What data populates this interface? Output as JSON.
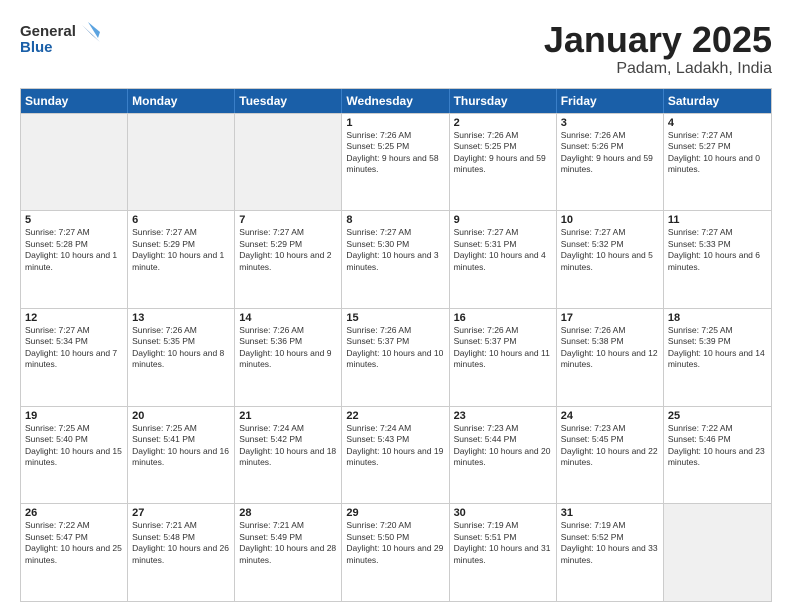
{
  "header": {
    "logo_general": "General",
    "logo_blue": "Blue",
    "month_title": "January 2025",
    "location": "Padam, Ladakh, India"
  },
  "weekdays": [
    "Sunday",
    "Monday",
    "Tuesday",
    "Wednesday",
    "Thursday",
    "Friday",
    "Saturday"
  ],
  "rows": [
    [
      {
        "day": "",
        "info": ""
      },
      {
        "day": "",
        "info": ""
      },
      {
        "day": "",
        "info": ""
      },
      {
        "day": "1",
        "info": "Sunrise: 7:26 AM\nSunset: 5:25 PM\nDaylight: 9 hours and 58 minutes."
      },
      {
        "day": "2",
        "info": "Sunrise: 7:26 AM\nSunset: 5:25 PM\nDaylight: 9 hours and 59 minutes."
      },
      {
        "day": "3",
        "info": "Sunrise: 7:26 AM\nSunset: 5:26 PM\nDaylight: 9 hours and 59 minutes."
      },
      {
        "day": "4",
        "info": "Sunrise: 7:27 AM\nSunset: 5:27 PM\nDaylight: 10 hours and 0 minutes."
      }
    ],
    [
      {
        "day": "5",
        "info": "Sunrise: 7:27 AM\nSunset: 5:28 PM\nDaylight: 10 hours and 1 minute."
      },
      {
        "day": "6",
        "info": "Sunrise: 7:27 AM\nSunset: 5:29 PM\nDaylight: 10 hours and 1 minute."
      },
      {
        "day": "7",
        "info": "Sunrise: 7:27 AM\nSunset: 5:29 PM\nDaylight: 10 hours and 2 minutes."
      },
      {
        "day": "8",
        "info": "Sunrise: 7:27 AM\nSunset: 5:30 PM\nDaylight: 10 hours and 3 minutes."
      },
      {
        "day": "9",
        "info": "Sunrise: 7:27 AM\nSunset: 5:31 PM\nDaylight: 10 hours and 4 minutes."
      },
      {
        "day": "10",
        "info": "Sunrise: 7:27 AM\nSunset: 5:32 PM\nDaylight: 10 hours and 5 minutes."
      },
      {
        "day": "11",
        "info": "Sunrise: 7:27 AM\nSunset: 5:33 PM\nDaylight: 10 hours and 6 minutes."
      }
    ],
    [
      {
        "day": "12",
        "info": "Sunrise: 7:27 AM\nSunset: 5:34 PM\nDaylight: 10 hours and 7 minutes."
      },
      {
        "day": "13",
        "info": "Sunrise: 7:26 AM\nSunset: 5:35 PM\nDaylight: 10 hours and 8 minutes."
      },
      {
        "day": "14",
        "info": "Sunrise: 7:26 AM\nSunset: 5:36 PM\nDaylight: 10 hours and 9 minutes."
      },
      {
        "day": "15",
        "info": "Sunrise: 7:26 AM\nSunset: 5:37 PM\nDaylight: 10 hours and 10 minutes."
      },
      {
        "day": "16",
        "info": "Sunrise: 7:26 AM\nSunset: 5:37 PM\nDaylight: 10 hours and 11 minutes."
      },
      {
        "day": "17",
        "info": "Sunrise: 7:26 AM\nSunset: 5:38 PM\nDaylight: 10 hours and 12 minutes."
      },
      {
        "day": "18",
        "info": "Sunrise: 7:25 AM\nSunset: 5:39 PM\nDaylight: 10 hours and 14 minutes."
      }
    ],
    [
      {
        "day": "19",
        "info": "Sunrise: 7:25 AM\nSunset: 5:40 PM\nDaylight: 10 hours and 15 minutes."
      },
      {
        "day": "20",
        "info": "Sunrise: 7:25 AM\nSunset: 5:41 PM\nDaylight: 10 hours and 16 minutes."
      },
      {
        "day": "21",
        "info": "Sunrise: 7:24 AM\nSunset: 5:42 PM\nDaylight: 10 hours and 18 minutes."
      },
      {
        "day": "22",
        "info": "Sunrise: 7:24 AM\nSunset: 5:43 PM\nDaylight: 10 hours and 19 minutes."
      },
      {
        "day": "23",
        "info": "Sunrise: 7:23 AM\nSunset: 5:44 PM\nDaylight: 10 hours and 20 minutes."
      },
      {
        "day": "24",
        "info": "Sunrise: 7:23 AM\nSunset: 5:45 PM\nDaylight: 10 hours and 22 minutes."
      },
      {
        "day": "25",
        "info": "Sunrise: 7:22 AM\nSunset: 5:46 PM\nDaylight: 10 hours and 23 minutes."
      }
    ],
    [
      {
        "day": "26",
        "info": "Sunrise: 7:22 AM\nSunset: 5:47 PM\nDaylight: 10 hours and 25 minutes."
      },
      {
        "day": "27",
        "info": "Sunrise: 7:21 AM\nSunset: 5:48 PM\nDaylight: 10 hours and 26 minutes."
      },
      {
        "day": "28",
        "info": "Sunrise: 7:21 AM\nSunset: 5:49 PM\nDaylight: 10 hours and 28 minutes."
      },
      {
        "day": "29",
        "info": "Sunrise: 7:20 AM\nSunset: 5:50 PM\nDaylight: 10 hours and 29 minutes."
      },
      {
        "day": "30",
        "info": "Sunrise: 7:19 AM\nSunset: 5:51 PM\nDaylight: 10 hours and 31 minutes."
      },
      {
        "day": "31",
        "info": "Sunrise: 7:19 AM\nSunset: 5:52 PM\nDaylight: 10 hours and 33 minutes."
      },
      {
        "day": "",
        "info": ""
      }
    ]
  ]
}
